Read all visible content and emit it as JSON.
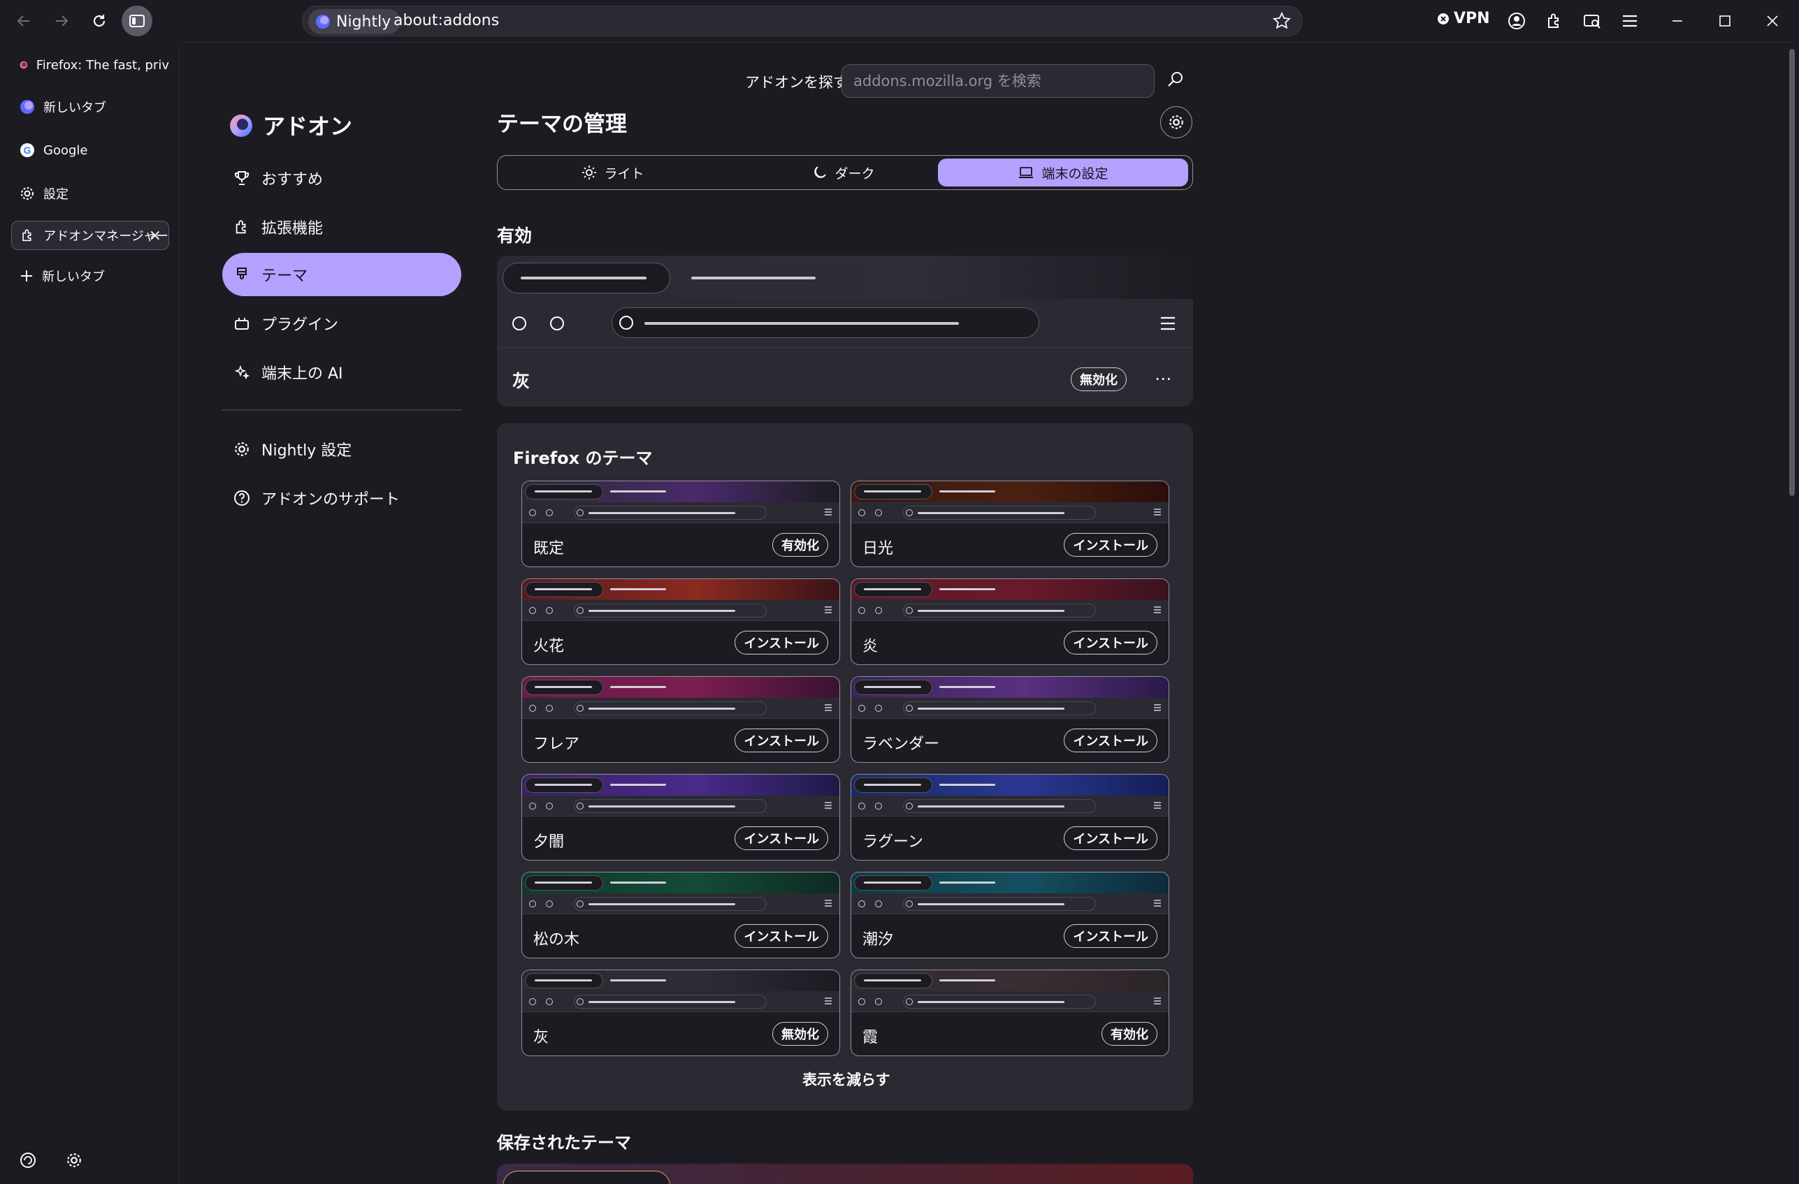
{
  "toolbar": {
    "identity_label": "Nightly",
    "url": "about:addons",
    "vpn_label": "VPN"
  },
  "tabs": [
    {
      "label": "Firefox: The fast, priv",
      "icon": "firefox-icon"
    },
    {
      "label": "新しいタブ",
      "icon": "nightly-icon"
    },
    {
      "label": "Google",
      "icon": "google-icon"
    },
    {
      "label": "設定",
      "icon": "gear-icon"
    },
    {
      "label": "アドオンマネージャー",
      "icon": "puzzle-icon",
      "selected": true
    },
    {
      "label": "新しいタブ",
      "icon": "plus-icon"
    }
  ],
  "search": {
    "label": "アドオンを探す",
    "placeholder": "addons.mozilla.org を検索"
  },
  "brand": {
    "label": "アドオン"
  },
  "categories": [
    {
      "label": "おすすめ",
      "icon": "trophy-icon"
    },
    {
      "label": "拡張機能",
      "icon": "puzzle-icon"
    },
    {
      "label": "テーマ",
      "icon": "brush-icon",
      "selected": true
    },
    {
      "label": "プラグイン",
      "icon": "plugin-icon"
    },
    {
      "label": "端末上の AI",
      "icon": "sparkle-icon"
    }
  ],
  "footer_links": [
    {
      "label": "Nightly 設定",
      "icon": "gear-icon"
    },
    {
      "label": "アドオンのサポート",
      "icon": "help-icon"
    }
  ],
  "main": {
    "title": "テーマの管理",
    "appearance": [
      {
        "label": "ライト",
        "icon": "sun-icon"
      },
      {
        "label": "ダーク",
        "icon": "moon-icon"
      },
      {
        "label": "端末の設定",
        "icon": "laptop-icon",
        "selected": true
      }
    ],
    "enabled_heading": "有効",
    "active_theme": {
      "name": "灰",
      "button": "無効化"
    },
    "firefox_themes_heading": "Firefox のテーマ",
    "themes": [
      {
        "name": "既定",
        "button": "有効化",
        "gradient": [
          "#2b2a33",
          "#4a2a6a",
          "#1c1b22"
        ]
      },
      {
        "name": "日光",
        "button": "インストール",
        "gradient": [
          "#3a1a12",
          "#4a2010",
          "#2a0e0a"
        ]
      },
      {
        "name": "火花",
        "button": "インストール",
        "gradient": [
          "#5a1820",
          "#8a2a20",
          "#3a1418"
        ]
      },
      {
        "name": "炎",
        "button": "インストール",
        "gradient": [
          "#5a1828",
          "#6a1a2a",
          "#3a1220"
        ]
      },
      {
        "name": "フレア",
        "button": "インストール",
        "gradient": [
          "#6a1a4a",
          "#7a1e50",
          "#3a1230"
        ]
      },
      {
        "name": "ラベンダー",
        "button": "インストール",
        "gradient": [
          "#3a2458",
          "#5a3080",
          "#2a1a48"
        ]
      },
      {
        "name": "夕闇",
        "button": "インストール",
        "gradient": [
          "#3a2068",
          "#4a2a8a",
          "#1e1a48"
        ]
      },
      {
        "name": "ラグーン",
        "button": "インストール",
        "gradient": [
          "#1a2a6a",
          "#2a3890",
          "#141e58"
        ]
      },
      {
        "name": "松の木",
        "button": "インストール",
        "gradient": [
          "#0e3a2a",
          "#144a38",
          "#0e2a22"
        ]
      },
      {
        "name": "潮汐",
        "button": "インストール",
        "gradient": [
          "#0e3a48",
          "#145060",
          "#0e2a3a"
        ]
      },
      {
        "name": "灰",
        "button": "無効化",
        "gradient": [
          "#2b2a33",
          "#2e2d36",
          "#1c1b22"
        ]
      },
      {
        "name": "霞",
        "button": "有効化",
        "gradient": [
          "#2e2a30",
          "#3a2e34",
          "#2a2428"
        ]
      }
    ],
    "show_less": "表示を減らす",
    "saved_heading": "保存されたテーマ"
  },
  "colors": {
    "accent": "#b4a0ff",
    "background": "#1c1b22",
    "surface": "#2b2a33"
  }
}
